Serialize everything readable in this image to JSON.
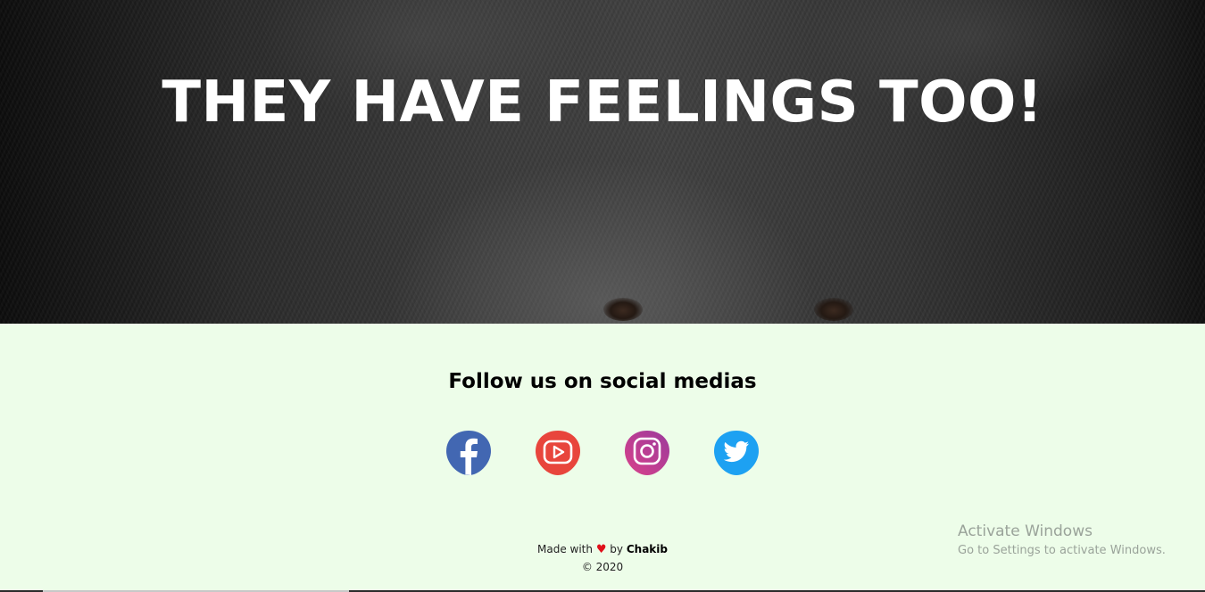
{
  "hero": {
    "title": "THEY HAVE FEELINGS TOO!"
  },
  "social": {
    "heading": "Follow us on social medias",
    "links": [
      {
        "name": "facebook",
        "icon": "facebook-icon",
        "color": "#4267b2"
      },
      {
        "name": "youtube",
        "icon": "youtube-icon",
        "color": "#e8453c"
      },
      {
        "name": "instagram",
        "icon": "instagram-icon",
        "color": "#c13584"
      },
      {
        "name": "twitter",
        "icon": "twitter-icon",
        "color": "#1da1f2"
      }
    ]
  },
  "footer": {
    "made_with_prefix": "Made with",
    "heart_icon": "heart-icon",
    "by": "by",
    "author": "Chakib",
    "copyright": "© 2020"
  },
  "watermark": {
    "title": "Activate Windows",
    "subtitle": "Go to Settings to activate Windows."
  },
  "colors": {
    "footer_bg": "#edfde9",
    "heart": "#e0101a"
  }
}
